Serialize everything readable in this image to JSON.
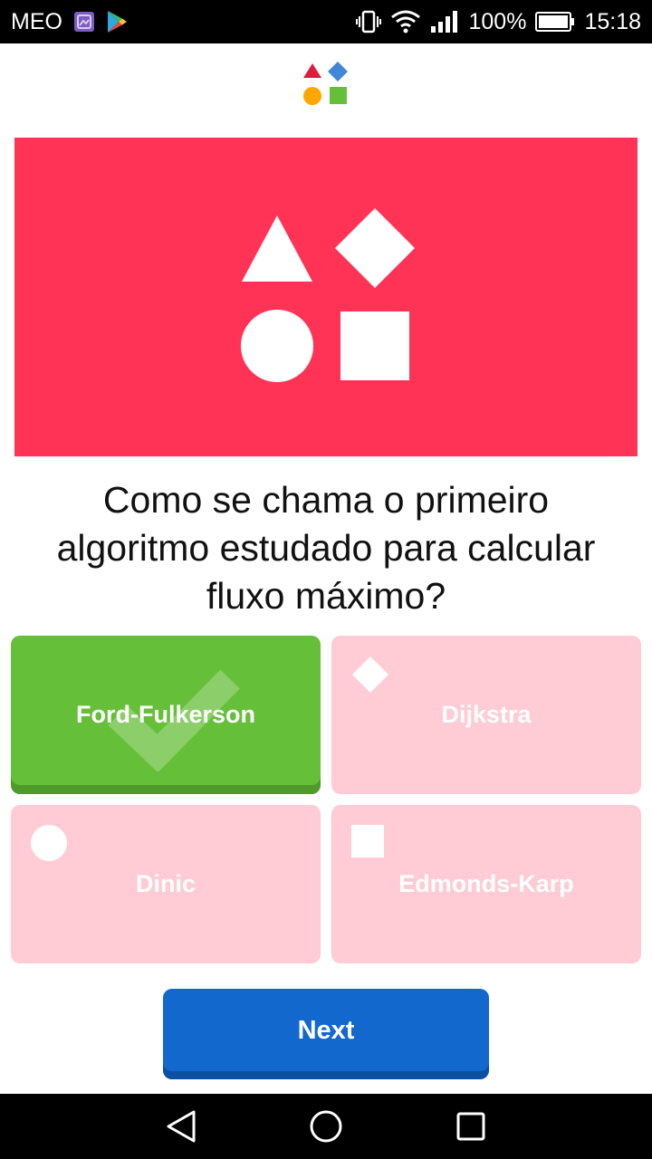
{
  "status_bar": {
    "carrier": "MEO",
    "battery": "100%",
    "time": "15:18",
    "icons": [
      "gallery-icon",
      "play-store-icon",
      "vibrate-icon",
      "wifi-icon",
      "signal-icon",
      "battery-icon"
    ]
  },
  "header": {
    "logo": "shapes-logo-icon"
  },
  "hero": {
    "background": "#ff3355",
    "icons": [
      "triangle-icon",
      "diamond-icon",
      "circle-icon",
      "square-icon"
    ]
  },
  "question": {
    "text": "Como se chama o primeiro algoritmo estudado para calcular fluxo máximo?"
  },
  "answers": [
    {
      "label": "Ford-Fulkerson",
      "state": "correct",
      "icon": "check-icon",
      "color": "#66bf39"
    },
    {
      "label": "Dijkstra",
      "state": "wrong",
      "icon": "diamond-icon",
      "color": "#ffccd5"
    },
    {
      "label": "Dinic",
      "state": "wrong",
      "icon": "circle-icon",
      "color": "#ffccd5"
    },
    {
      "label": "Edmonds-Karp",
      "state": "wrong",
      "icon": "square-icon",
      "color": "#ffccd5"
    }
  ],
  "next_button": {
    "label": "Next",
    "color": "#1368ce"
  },
  "nav_bar": {
    "buttons": [
      "back-icon",
      "home-icon",
      "recents-icon"
    ]
  }
}
